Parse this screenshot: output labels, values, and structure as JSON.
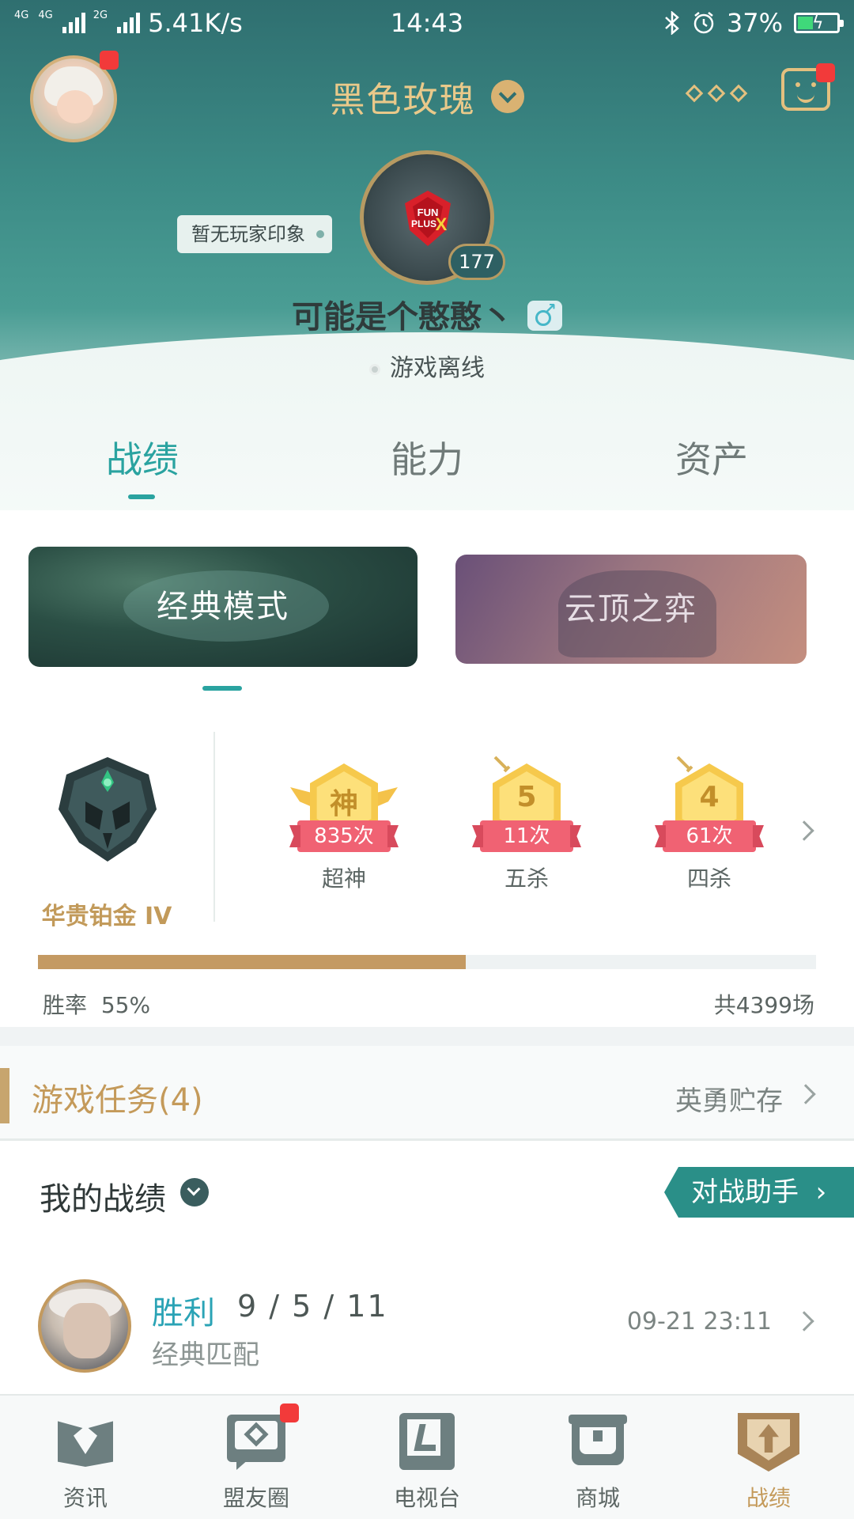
{
  "status_bar": {
    "net_type_1": "4G",
    "net_type_2": "4G",
    "net_type_3": "2G",
    "speed": "5.41K/s",
    "time": "14:43",
    "battery": "37%",
    "battery_level": 0.37
  },
  "header": {
    "title": "黑色玫瑰",
    "impression_tag": "暂无玩家印象",
    "level": "177",
    "player_name": "可能是个憨憨丶",
    "status": "游戏离线",
    "team_logo_text_1": "FUN",
    "team_logo_text_2": "PLUS",
    "team_logo_text_3": "X"
  },
  "tabs": [
    {
      "label": "战绩",
      "active": true
    },
    {
      "label": "能力",
      "active": false
    },
    {
      "label": "资产",
      "active": false
    }
  ],
  "modes": [
    {
      "label": "经典模式",
      "active": true
    },
    {
      "label": "云顶之弈",
      "active": false
    }
  ],
  "rank": {
    "name": "华贵铂金 IV"
  },
  "achievements": [
    {
      "glyph": "神",
      "count": "835次",
      "label": "超神"
    },
    {
      "glyph": "5",
      "count": "11次",
      "label": "五杀"
    },
    {
      "glyph": "4",
      "count": "61次",
      "label": "四杀"
    }
  ],
  "stats": {
    "win_rate_label": "胜率",
    "win_rate": "55%",
    "win_rate_fraction": 0.55,
    "total": "共4399场"
  },
  "tasks": {
    "title": "游戏任务(4)",
    "link": "英勇贮存"
  },
  "record": {
    "title": "我的战绩",
    "assist_button": "对战助手",
    "items": [
      {
        "result": "胜利",
        "kda": "9 / 5 / 11",
        "mode": "经典匹配",
        "time": "09-21 23:11"
      }
    ]
  },
  "bottom_nav": [
    {
      "label": "资讯",
      "active": false
    },
    {
      "label": "盟友圈",
      "active": false
    },
    {
      "label": "电视台",
      "active": false
    },
    {
      "label": "商城",
      "active": false
    },
    {
      "label": "战绩",
      "active": true
    }
  ],
  "colors": {
    "accent": "#2aa3a0",
    "gold": "#c49a5a",
    "badge_red": "#f23a3a"
  }
}
